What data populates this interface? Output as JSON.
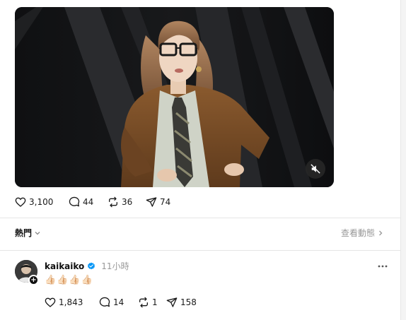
{
  "post": {
    "video": {
      "muted": true,
      "mute_icon": "speaker-muted-icon"
    },
    "stats": {
      "likes": "3,100",
      "replies": "44",
      "reposts": "36",
      "shares": "74"
    }
  },
  "filter": {
    "label": "熱門",
    "activity_label": "查看動態"
  },
  "reply": {
    "username": "kaikaiko",
    "verified": true,
    "time": "11小時",
    "text": "👍🏻👍🏻👍🏻👍🏻",
    "stats": {
      "likes": "1,843",
      "replies": "14",
      "reposts": "1",
      "shares": "158"
    }
  },
  "colors": {
    "muted_text": "#999999",
    "verified_blue": "#0095f6",
    "divider": "#e5e5e5"
  }
}
